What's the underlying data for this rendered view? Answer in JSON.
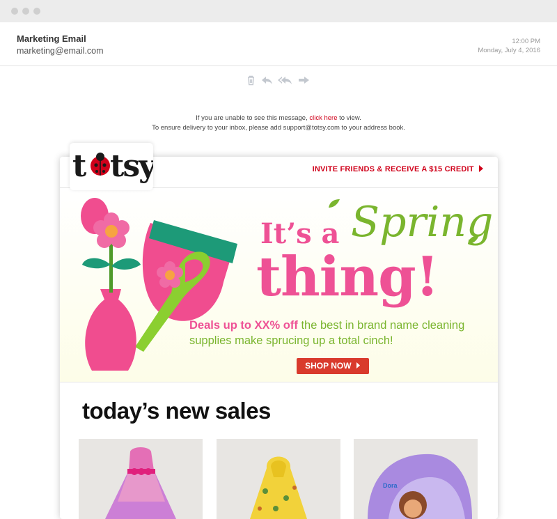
{
  "window": {
    "controls": [
      "close",
      "minimize",
      "maximize"
    ]
  },
  "email": {
    "sender_name": "Marketing Email",
    "sender_email": "marketing@email.com",
    "time": "12:00 PM",
    "date": "Monday, July 4, 2016"
  },
  "actions": [
    {
      "icon": "trash-icon"
    },
    {
      "icon": "reply-icon"
    },
    {
      "icon": "reply-all-icon"
    },
    {
      "icon": "forward-icon"
    }
  ],
  "notice": {
    "line1_prefix": "If you are unable to see this message,",
    "line1_link": "click here",
    "line1_suffix": "to view.",
    "line2": "To ensure delivery to your inbox, please add support@totsy.com to your address book."
  },
  "brand": {
    "logo": "totsy",
    "color": "#d0021b"
  },
  "invite": {
    "label": "INVITE FRIENDS & RECEIVE A $15 CREDIT"
  },
  "hero": {
    "its_a": "It’s a",
    "spring": "Spring",
    "thing": "thing!",
    "deals_bold": "Deals up to XX% off",
    "deals_rest": "the best in brand name cleaning supplies make sprucing up a total cinch!",
    "cta": "SHOP NOW"
  },
  "sales": {
    "title": "today’s new sales",
    "items": [
      {
        "name": "tie-dye-dress"
      },
      {
        "name": "yellow-raincoat"
      },
      {
        "name": "dora-cap"
      }
    ]
  },
  "colors": {
    "pink": "#ee5195",
    "green": "#7ab52e",
    "red": "#d93a2c"
  }
}
